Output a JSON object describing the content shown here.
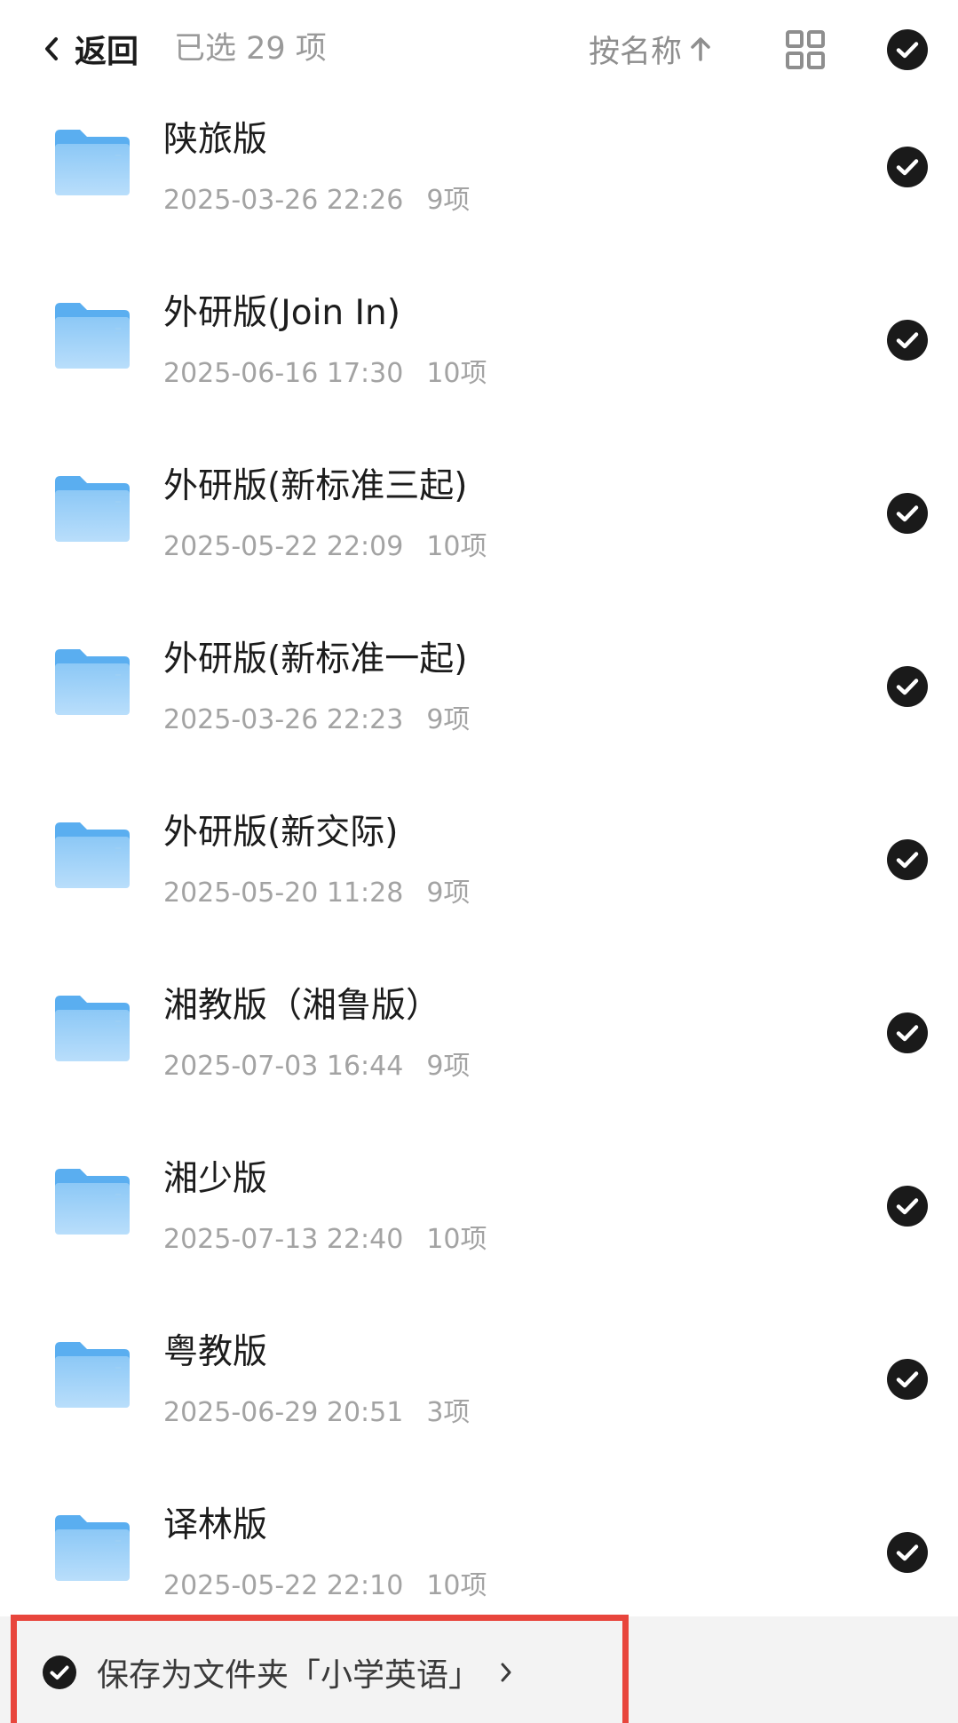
{
  "header": {
    "back_label": "返回",
    "selected_text": "已选 29 项",
    "sort_label": "按名称",
    "sort_direction_icon": "arrow-up-icon",
    "view_toggle_icon": "grid-view-icon",
    "select_all_icon": "check-circle-icon"
  },
  "folders": [
    {
      "name": "陕旅版",
      "date": "2025-03-26 22:26",
      "count": "9项"
    },
    {
      "name": "外研版(Join In)",
      "date": "2025-06-16 17:30",
      "count": "10项"
    },
    {
      "name": "外研版(新标准三起)",
      "date": "2025-05-22 22:09",
      "count": "10项"
    },
    {
      "name": "外研版(新标准一起)",
      "date": "2025-03-26 22:23",
      "count": "9项"
    },
    {
      "name": "外研版(新交际)",
      "date": "2025-05-20 11:28",
      "count": "9项"
    },
    {
      "name": "湘教版（湘鲁版）",
      "date": "2025-07-03 16:44",
      "count": "9项"
    },
    {
      "name": "湘少版",
      "date": "2025-07-13 22:40",
      "count": "10项"
    },
    {
      "name": "粤教版",
      "date": "2025-06-29 20:51",
      "count": "3项"
    },
    {
      "name": "译林版",
      "date": "2025-05-22 22:10",
      "count": "10项"
    }
  ],
  "bottom": {
    "save_label": "保存为文件夹「小学英语」",
    "chevron_icon": "chevron-right-icon"
  },
  "colors": {
    "folder_blue": "#5aaef0",
    "check_fill": "#1a1a1a",
    "highlight_border": "#e8453c"
  }
}
